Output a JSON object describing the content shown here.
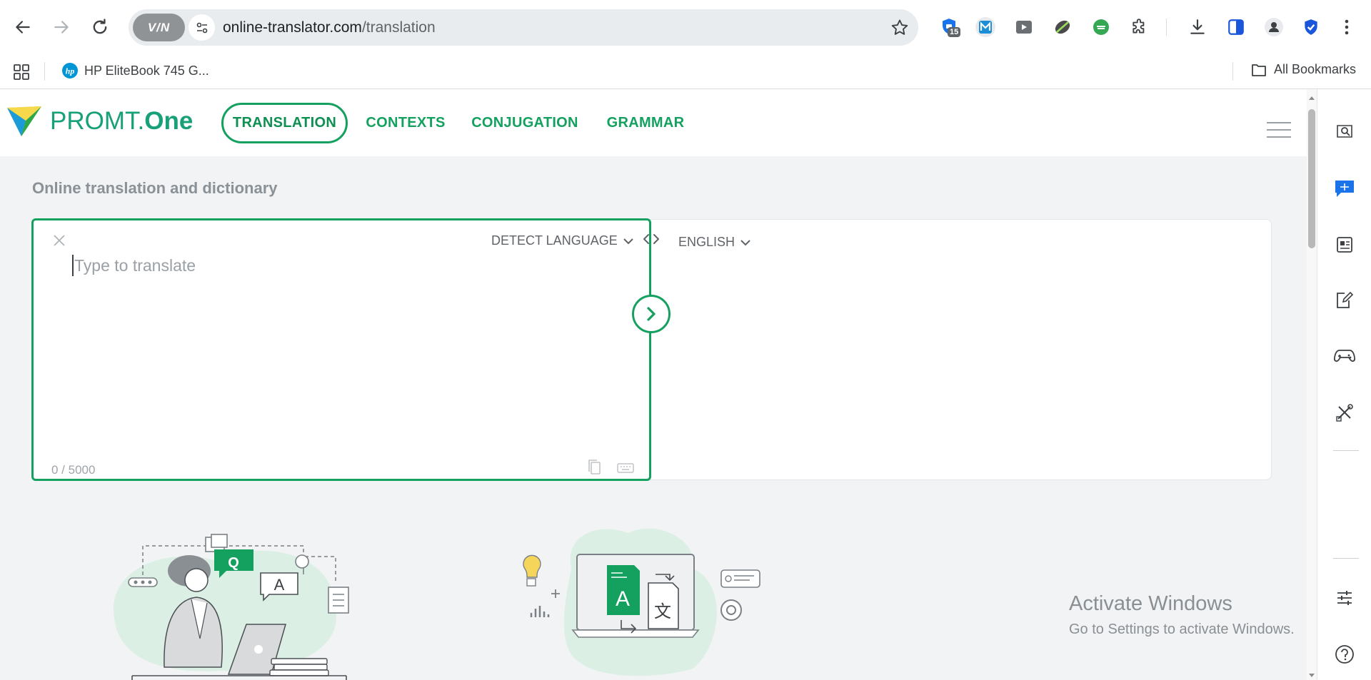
{
  "browser": {
    "url_domain": "online-translator.com",
    "url_path": "/translation",
    "vpn_label": "V/N",
    "extension_badge": "15",
    "bookmarks": {
      "item": "HP EliteBook 745 G...",
      "all": "All Bookmarks"
    }
  },
  "site": {
    "logo_prefix": "PROMT.",
    "logo_suffix": "One",
    "nav": [
      "TRANSLATION",
      "CONTEXTS",
      "CONJUGATION",
      "GRAMMAR"
    ],
    "subtitle": "Online translation and dictionary"
  },
  "translator": {
    "source_language": "DETECT LANGUAGE",
    "target_language": "ENGLISH",
    "placeholder": "Type to translate",
    "char_count": "0 / 5000"
  },
  "illustrations": {
    "bubble_q": "Q",
    "bubble_a": "A",
    "doc_a": "A",
    "doc_x": "文"
  },
  "windows_watermark": {
    "title": "Activate Windows",
    "subtitle": "Go to Settings to activate Windows."
  },
  "colors": {
    "brand_green": "#14a15f",
    "logo_teal": "#18a078",
    "page_bg": "#f2f3f5"
  }
}
